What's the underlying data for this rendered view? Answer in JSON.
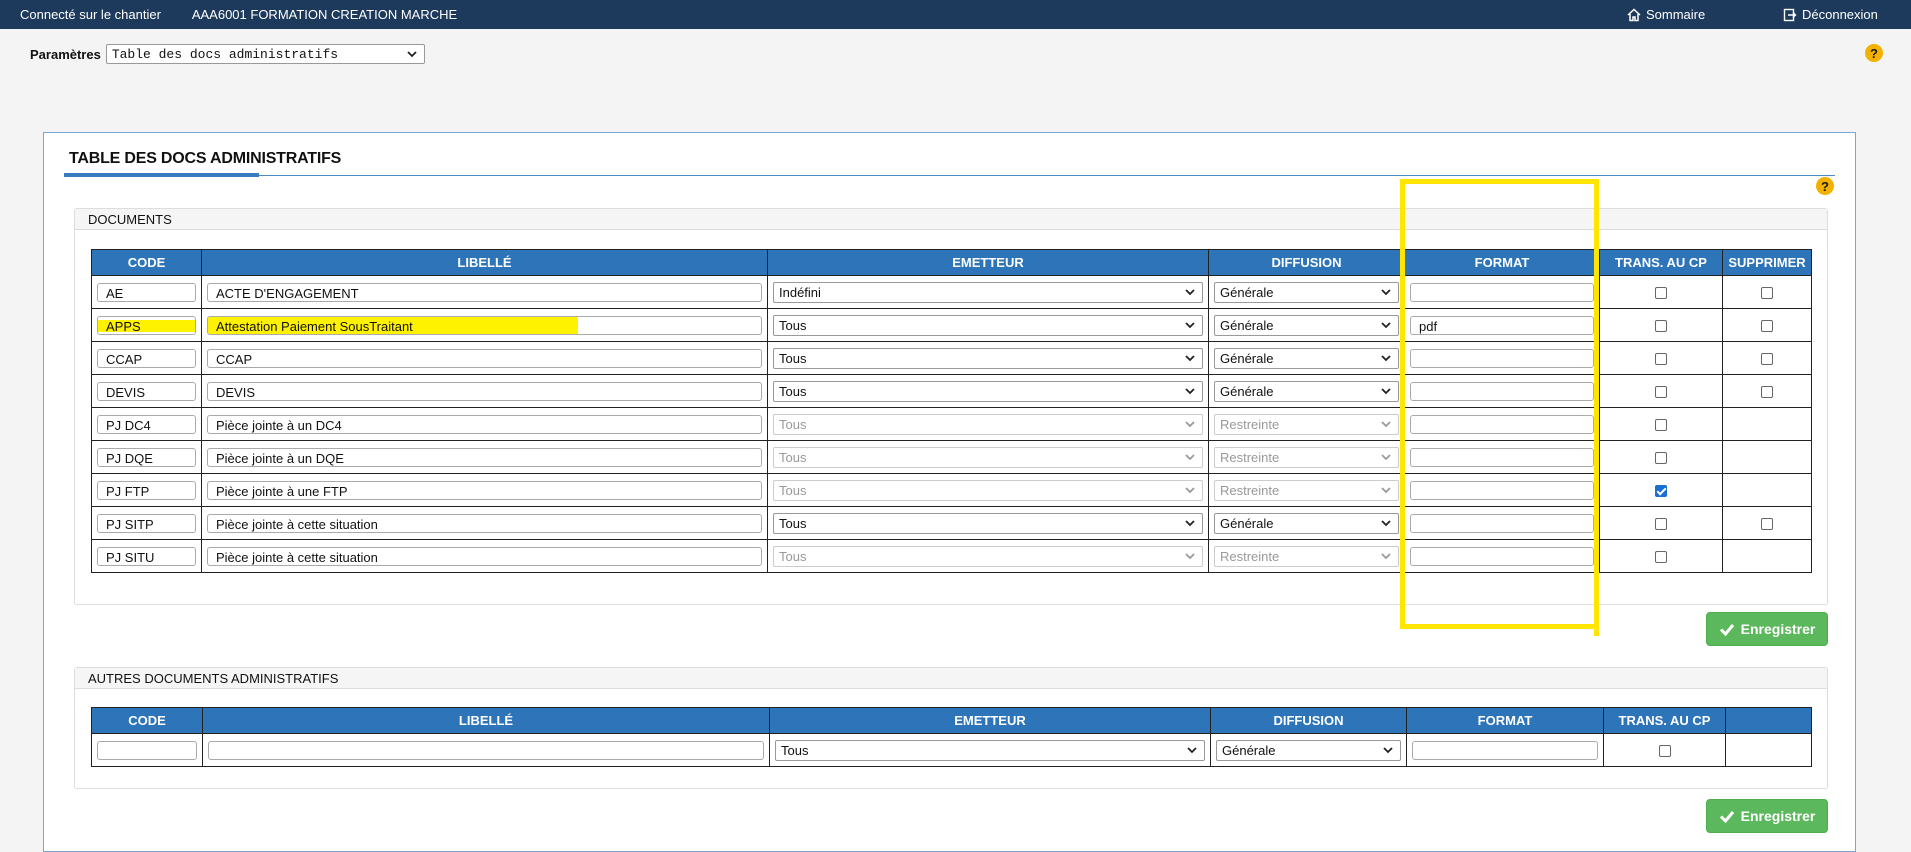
{
  "topbar": {
    "chantier_label": "Connecté sur le chantier",
    "chantier_name": "AAA6001 FORMATION CREATION MARCHE",
    "sommaire": "Sommaire",
    "deconnexion": "Déconnexion"
  },
  "params": {
    "label": "Paramètres",
    "selected": "Table des docs administratifs"
  },
  "help_glyph": "?",
  "panel": {
    "title": "TABLE DES DOCS ADMINISTRATIFS"
  },
  "documents": {
    "heading": "DOCUMENTS",
    "columns": [
      "CODE",
      "LIBELLÉ",
      "EMETTEUR",
      "DIFFUSION",
      "FORMAT",
      "TRANS. AU CP",
      "SUPPRIMER"
    ],
    "rows": [
      {
        "code": "AE",
        "libelle": "ACTE D'ENGAGEMENT",
        "emetteur": "Indéfini",
        "diffusion": "Générale",
        "format": "",
        "trans": false,
        "supprimer": false
      },
      {
        "code": "APPS",
        "libelle": "Attestation Paiement SousTraitant",
        "emetteur": "Tous",
        "diffusion": "Générale",
        "format": "pdf",
        "trans": false,
        "supprimer": false
      },
      {
        "code": "CCAP",
        "libelle": "CCAP",
        "emetteur": "Tous",
        "diffusion": "Générale",
        "format": "",
        "trans": false,
        "supprimer": false
      },
      {
        "code": "DEVIS",
        "libelle": "DEVIS",
        "emetteur": "Tous",
        "diffusion": "Générale",
        "format": "",
        "trans": false,
        "supprimer": false
      },
      {
        "code": "PJ DC4",
        "libelle": "Pièce jointe à un DC4",
        "emetteur": "Tous",
        "diffusion": "Restreinte",
        "format": "",
        "trans": false,
        "supprimer": null
      },
      {
        "code": "PJ DQE",
        "libelle": "Pièce jointe à un DQE",
        "emetteur": "Tous",
        "diffusion": "Restreinte",
        "format": "",
        "trans": false,
        "supprimer": null
      },
      {
        "code": "PJ FTP",
        "libelle": "Pièce jointe à une FTP",
        "emetteur": "Tous",
        "diffusion": "Restreinte",
        "format": "",
        "trans": true,
        "supprimer": null
      },
      {
        "code": "PJ SITP",
        "libelle": "Pièce jointe à cette situation",
        "emetteur": "Tous",
        "diffusion": "Générale",
        "format": "",
        "trans": false,
        "supprimer": false
      },
      {
        "code": "PJ SITU",
        "libelle": "Pièce jointe à cette situation",
        "emetteur": "Tous",
        "diffusion": "Restreinte",
        "format": "",
        "trans": false,
        "supprimer": null
      }
    ],
    "save_label": "Enregistrer"
  },
  "autres": {
    "heading": "AUTRES DOCUMENTS ADMINISTRATIFS",
    "columns": [
      "CODE",
      "LIBELLÉ",
      "EMETTEUR",
      "DIFFUSION",
      "FORMAT",
      "TRANS. AU CP",
      ""
    ],
    "new_row": {
      "code": "",
      "libelle": "",
      "emetteur": "Tous",
      "diffusion": "Générale",
      "format": "",
      "trans": false
    },
    "save_label": "Enregistrer"
  },
  "colors": {
    "topbar": "#1d3a5c",
    "table_header": "#2d74b8",
    "save_button": "#5cb85c",
    "highlight": "#fff200",
    "help": "#f3b200"
  },
  "icons": {
    "sommaire": "home-icon",
    "deconnexion": "logout-icon",
    "save": "check-icon",
    "help": "help-icon"
  }
}
